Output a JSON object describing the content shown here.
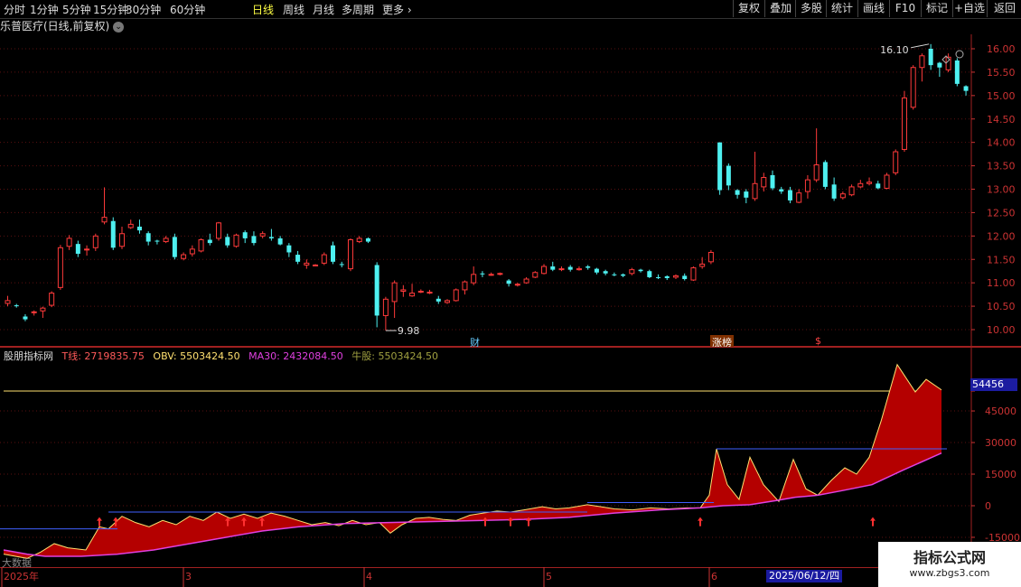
{
  "toolbar": {
    "periods": [
      "分时",
      "1分钟",
      "5分钟",
      "15分钟",
      "30分钟",
      "60分钟",
      "日线",
      "周线",
      "月线",
      "多周期",
      "更多"
    ],
    "active_period": "日线",
    "right_buttons": [
      "复权",
      "叠加",
      "多股",
      "统计",
      "画线",
      "F10",
      "+自选",
      "返回"
    ],
    "extra_button": "标记"
  },
  "stock": {
    "title": "乐普医疗(日线,前复权)"
  },
  "price_axis": [
    "16.00",
    "15.50",
    "15.00",
    "14.50",
    "14.00",
    "13.50",
    "13.00",
    "12.50",
    "12.00",
    "11.50",
    "11.00",
    "10.50",
    "10.00"
  ],
  "annotations": {
    "high": "16.10",
    "low": "9.98",
    "cai": "财",
    "zhangbang": "涨榜",
    "s": "$"
  },
  "indicator": {
    "name": "股朋指标网",
    "tline_label": "T线: 2719835.75",
    "obv_label": "OBV: 5503424.50",
    "ma30_label": "MA30: 2432084.50",
    "niugu_label": "牛股: 5503424.50",
    "axis": [
      "54456",
      "45000",
      "30000",
      "15000",
      "0",
      "-15000"
    ],
    "current_tag": "54456"
  },
  "dates": [
    "2025年",
    "3",
    "4",
    "5",
    "6"
  ],
  "selected_date": "2025/06/12/四",
  "bottom_text": "大数据",
  "watermark": {
    "line1": "指标公式网",
    "line2": "www.zbgs3.com"
  },
  "colors": {
    "up": "#ff3a3a",
    "down": "#4ef0f0",
    "obv_fill": "#b40000",
    "ma30": "#e040e0",
    "tline": "#ffe070",
    "level": "#4060ff"
  },
  "chart_data": {
    "type": "candlestick",
    "candles": [
      [
        10.56,
        10.62,
        10.72,
        10.5
      ],
      [
        10.52,
        10.5,
        10.55,
        10.47
      ],
      [
        10.28,
        10.22,
        10.33,
        10.18
      ],
      [
        10.36,
        10.38,
        10.41,
        10.3
      ],
      [
        10.4,
        10.46,
        10.49,
        10.25
      ],
      [
        10.52,
        10.78,
        10.82,
        10.48
      ],
      [
        10.9,
        11.75,
        11.81,
        10.85
      ],
      [
        11.78,
        11.95,
        12.02,
        11.7
      ],
      [
        11.83,
        11.62,
        11.9,
        11.55
      ],
      [
        11.72,
        11.72,
        11.8,
        11.58
      ],
      [
        11.75,
        12.0,
        12.05,
        11.68
      ],
      [
        12.3,
        12.4,
        13.04,
        12.25
      ],
      [
        12.32,
        11.75,
        12.4,
        11.7
      ],
      [
        11.78,
        12.05,
        12.2,
        11.72
      ],
      [
        12.18,
        12.25,
        12.35,
        12.15
      ],
      [
        12.2,
        12.12,
        12.35,
        12.05
      ],
      [
        12.06,
        11.88,
        12.1,
        11.8
      ],
      [
        11.9,
        11.88,
        11.92,
        11.82
      ],
      [
        11.88,
        11.95,
        12.0,
        11.85
      ],
      [
        11.98,
        11.55,
        12.05,
        11.5
      ],
      [
        11.52,
        11.6,
        11.65,
        11.48
      ],
      [
        11.62,
        11.72,
        11.8,
        11.56
      ],
      [
        11.68,
        11.92,
        11.95,
        11.65
      ],
      [
        11.92,
        11.85,
        12.05,
        11.8
      ],
      [
        11.95,
        12.28,
        12.3,
        11.9
      ],
      [
        11.98,
        11.8,
        12.05,
        11.75
      ],
      [
        11.78,
        12.02,
        12.05,
        11.75
      ],
      [
        12.08,
        11.95,
        12.12,
        11.85
      ],
      [
        12.0,
        11.85,
        12.1,
        11.8
      ],
      [
        12.0,
        12.05,
        12.1,
        11.95
      ],
      [
        11.98,
        11.95,
        12.15,
        11.9
      ],
      [
        11.95,
        11.82,
        12.0,
        11.8
      ],
      [
        11.8,
        11.65,
        11.85,
        11.55
      ],
      [
        11.6,
        11.45,
        11.68,
        11.4
      ],
      [
        11.38,
        11.42,
        11.5,
        11.3
      ],
      [
        11.38,
        11.38,
        11.4,
        11.36
      ],
      [
        11.42,
        11.6,
        11.65,
        11.38
      ],
      [
        11.8,
        11.45,
        11.88,
        11.4
      ],
      [
        11.4,
        11.38,
        11.45,
        11.33
      ],
      [
        11.3,
        11.92,
        11.95,
        11.25
      ],
      [
        11.88,
        11.95,
        12.0,
        11.85
      ],
      [
        11.95,
        11.88,
        11.97,
        11.85
      ],
      [
        11.38,
        10.3,
        11.44,
        10.05
      ],
      [
        10.3,
        10.65,
        10.7,
        9.98
      ],
      [
        10.6,
        11.0,
        11.05,
        10.25
      ],
      [
        10.82,
        10.85,
        10.95,
        10.7
      ],
      [
        10.72,
        10.78,
        10.98,
        10.7
      ],
      [
        10.8,
        10.82,
        10.86,
        10.78
      ],
      [
        10.78,
        10.8,
        10.85,
        10.76
      ],
      [
        10.66,
        10.6,
        10.72,
        10.55
      ],
      [
        10.58,
        10.62,
        10.65,
        10.55
      ],
      [
        10.62,
        10.85,
        10.88,
        10.6
      ],
      [
        10.85,
        11.02,
        11.05,
        10.75
      ],
      [
        11.0,
        11.18,
        11.35,
        10.95
      ],
      [
        11.2,
        11.18,
        11.25,
        11.12
      ],
      [
        11.18,
        11.18,
        11.22,
        11.15
      ],
      [
        11.2,
        11.2,
        11.22,
        11.16
      ],
      [
        11.05,
        10.98,
        11.08,
        10.92
      ],
      [
        10.95,
        10.97,
        11.0,
        10.92
      ],
      [
        11.0,
        11.08,
        11.12,
        10.98
      ],
      [
        11.12,
        11.22,
        11.25,
        11.1
      ],
      [
        11.2,
        11.35,
        11.4,
        11.18
      ],
      [
        11.35,
        11.28,
        11.45,
        11.25
      ],
      [
        11.3,
        11.3,
        11.35,
        11.25
      ],
      [
        11.34,
        11.28,
        11.38,
        11.24
      ],
      [
        11.28,
        11.3,
        11.35,
        11.26
      ],
      [
        11.35,
        11.32,
        11.38,
        11.28
      ],
      [
        11.3,
        11.22,
        11.32,
        11.18
      ],
      [
        11.25,
        11.2,
        11.28,
        11.16
      ],
      [
        11.18,
        11.17,
        11.22,
        11.14
      ],
      [
        11.18,
        11.15,
        11.2,
        11.12
      ],
      [
        11.2,
        11.28,
        11.32,
        11.16
      ],
      [
        11.28,
        11.25,
        11.3,
        11.22
      ],
      [
        11.25,
        11.12,
        11.28,
        11.1
      ],
      [
        11.12,
        11.1,
        11.18,
        11.08
      ],
      [
        11.14,
        11.1,
        11.16,
        11.06
      ],
      [
        11.12,
        11.15,
        11.18,
        11.08
      ],
      [
        11.15,
        11.08,
        11.2,
        11.05
      ],
      [
        11.06,
        11.32,
        11.35,
        11.04
      ],
      [
        11.35,
        11.4,
        11.55,
        11.3
      ],
      [
        11.45,
        11.65,
        11.7,
        11.4
      ],
      [
        14.0,
        12.98,
        14.0,
        12.88
      ],
      [
        13.5,
        13.08,
        13.55,
        12.98
      ],
      [
        12.98,
        12.88,
        13.0,
        12.8
      ],
      [
        12.95,
        12.82,
        13.0,
        12.7
      ],
      [
        12.8,
        13.12,
        13.8,
        12.75
      ],
      [
        13.05,
        13.25,
        13.35,
        12.95
      ],
      [
        13.3,
        13.02,
        13.4,
        12.98
      ],
      [
        13.0,
        12.95,
        13.05,
        12.9
      ],
      [
        12.98,
        12.76,
        13.05,
        12.7
      ],
      [
        12.72,
        12.92,
        13.0,
        12.7
      ],
      [
        12.95,
        13.2,
        13.3,
        12.8
      ],
      [
        13.2,
        13.52,
        14.3,
        13.15
      ],
      [
        13.58,
        13.05,
        13.62,
        13.0
      ],
      [
        13.1,
        12.8,
        13.25,
        12.75
      ],
      [
        12.82,
        12.9,
        12.95,
        12.78
      ],
      [
        12.88,
        13.05,
        13.1,
        12.85
      ],
      [
        13.05,
        13.12,
        13.2,
        13.02
      ],
      [
        13.12,
        13.15,
        13.25,
        13.08
      ],
      [
        13.12,
        13.02,
        13.18,
        13.0
      ],
      [
        13.02,
        13.3,
        13.35,
        13.0
      ],
      [
        13.35,
        13.8,
        13.85,
        13.3
      ],
      [
        13.85,
        14.95,
        15.1,
        13.8
      ],
      [
        14.75,
        15.6,
        15.65,
        14.7
      ],
      [
        15.6,
        15.85,
        15.9,
        15.3
      ],
      [
        16.0,
        15.65,
        16.1,
        15.55
      ],
      [
        15.7,
        15.6,
        15.72,
        15.4
      ],
      [
        15.55,
        15.82,
        15.9,
        15.5
      ],
      [
        15.75,
        15.25,
        15.8,
        15.2
      ],
      [
        15.2,
        15.1,
        15.22,
        15.0
      ]
    ]
  }
}
